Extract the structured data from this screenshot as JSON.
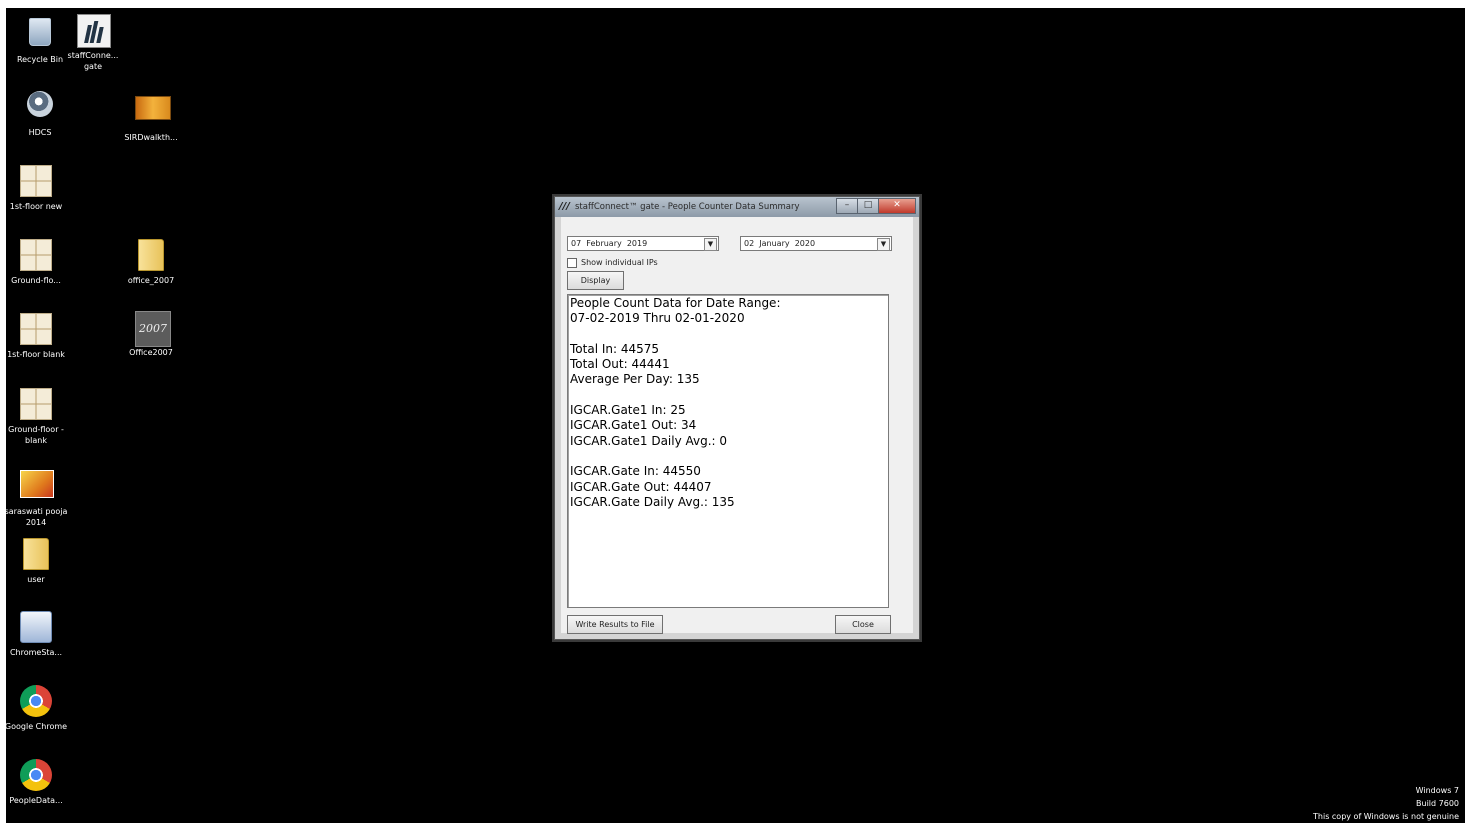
{
  "desktop": {
    "icons": [
      {
        "label": "Recycle Bin",
        "icon": "recycle-bin-icon"
      },
      {
        "label": "staffConne... gate",
        "icon": "staffconnect-app-icon"
      },
      {
        "label": "HDCS",
        "icon": "webcam-icon"
      },
      {
        "label": "SIRDwalkth...",
        "icon": "video-file-icon"
      },
      {
        "label": "1st-floor new",
        "icon": "floor-plan-icon"
      },
      {
        "label": "Ground-flo...",
        "icon": "floor-plan-icon"
      },
      {
        "label": "office_2007",
        "icon": "folder-icon"
      },
      {
        "label": "1st-floor blank",
        "icon": "floor-plan-icon"
      },
      {
        "label": "Office2007",
        "icon": "office2007-icon"
      },
      {
        "label": "Ground-floor - blank",
        "icon": "floor-plan-icon"
      },
      {
        "label": "saraswati pooja 2014",
        "icon": "photo-album-icon"
      },
      {
        "label": "user",
        "icon": "folder-icon"
      },
      {
        "label": "ChromeSta...",
        "icon": "installer-icon"
      },
      {
        "label": "Google Chrome",
        "icon": "chrome-icon"
      },
      {
        "label": "PeopleData...",
        "icon": "chrome-icon"
      }
    ],
    "watermark": {
      "line1": "Windows 7",
      "line2": "Build 7600",
      "line3": "This copy of Windows is not genuine"
    }
  },
  "dialog": {
    "title": "staffConnect™ gate - People Counter Data Summary",
    "app_icon_text": "///",
    "from_date": {
      "day": "07",
      "month": "February",
      "year": "2019"
    },
    "to_date": {
      "day": "02",
      "month": "January",
      "year": "2020"
    },
    "show_individual_ips": {
      "label": "Show individual IPs",
      "checked": false
    },
    "display_button": "Display",
    "results": [
      "People Count Data for Date Range:",
      "07-02-2019 Thru 02-01-2020",
      "",
      "Total In: 44575",
      "Total Out: 44441",
      "Average Per Day: 135",
      "",
      "IGCAR.Gate1 In: 25",
      "IGCAR.Gate1 Out: 34",
      "IGCAR.Gate1 Daily Avg.: 0",
      "",
      "IGCAR.Gate In: 44550",
      "IGCAR.Gate Out: 44407",
      "IGCAR.Gate Daily Avg.: 135"
    ],
    "write_button": "Write Results to File",
    "close_button": "Close"
  }
}
